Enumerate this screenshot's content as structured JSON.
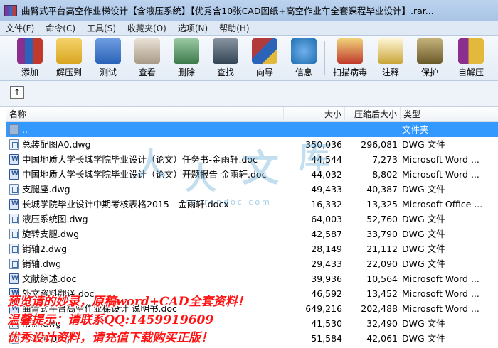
{
  "window": {
    "title": "曲臂式平台高空作业梯设计【含液压系统】【优秀含10张CAD图纸+高空作业车全套课程毕业设计】.rar..."
  },
  "menu": [
    "文件(F)",
    "命令(C)",
    "工具(S)",
    "收藏夹(O)",
    "选项(N)",
    "帮助(H)"
  ],
  "toolbar": [
    {
      "label": "添加",
      "icon": "add-books-icon",
      "color": "#8b2f8f"
    },
    {
      "label": "解压到",
      "icon": "extract-folder-icon",
      "color": "#d9a520"
    },
    {
      "label": "测试",
      "icon": "test-check-icon",
      "color": "#2a63b8"
    },
    {
      "label": "查看",
      "icon": "view-glasses-icon",
      "color": "#7b6a5a"
    },
    {
      "label": "删除",
      "icon": "delete-bin-icon",
      "color": "#3c7a4a"
    },
    {
      "label": "查找",
      "icon": "find-binoculars-icon",
      "color": "#334455"
    },
    {
      "label": "向导",
      "icon": "wizard-icon",
      "color": "#b33a3a"
    },
    {
      "label": "信息",
      "icon": "info-icon",
      "color": "#1f6fb3"
    },
    {
      "label": "扫描病毒",
      "icon": "scan-virus-icon",
      "color": "#c0392b"
    },
    {
      "label": "注释",
      "icon": "comment-icon",
      "color": "#c9a437"
    },
    {
      "label": "保护",
      "icon": "protect-shield-icon",
      "color": "#6b5a2a"
    },
    {
      "label": "自解压",
      "icon": "sfx-icon",
      "color": "#8b2f8f"
    }
  ],
  "address": {
    "up_label": "↑"
  },
  "columns": {
    "name": "名称",
    "size": "大小",
    "packed": "压缩后大小",
    "type": "类型"
  },
  "files": [
    {
      "name": "..",
      "size": "",
      "packed": "",
      "type": "文件夹",
      "kind": "folder",
      "selected": true
    },
    {
      "name": "总装配图A0.dwg",
      "size": "350,036",
      "packed": "296,081",
      "type": "DWG 文件",
      "kind": "dwg"
    },
    {
      "name": "中国地质大学长城学院毕业设计（论文）任务书-金雨轩.doc",
      "size": "44,544",
      "packed": "7,273",
      "type": "Microsoft Word ...",
      "kind": "word"
    },
    {
      "name": "中国地质大学长城学院毕业设计（论文）开题报告-金雨轩.doc",
      "size": "44,032",
      "packed": "8,802",
      "type": "Microsoft Word ...",
      "kind": "word"
    },
    {
      "name": "支腿座.dwg",
      "size": "49,433",
      "packed": "40,387",
      "type": "DWG 文件",
      "kind": "dwg"
    },
    {
      "name": "长城学院毕业设计中期考核表格2015 - 金雨轩.docx",
      "size": "16,332",
      "packed": "13,325",
      "type": "Microsoft Office ...",
      "kind": "word"
    },
    {
      "name": "液压系统图.dwg",
      "size": "64,003",
      "packed": "52,760",
      "type": "DWG 文件",
      "kind": "dwg"
    },
    {
      "name": "旋转支腿.dwg",
      "size": "42,587",
      "packed": "33,790",
      "type": "DWG 文件",
      "kind": "dwg"
    },
    {
      "name": "销轴2.dwg",
      "size": "28,149",
      "packed": "21,112",
      "type": "DWG 文件",
      "kind": "dwg"
    },
    {
      "name": "销轴.dwg",
      "size": "29,433",
      "packed": "22,090",
      "type": "DWG 文件",
      "kind": "dwg"
    },
    {
      "name": "文献综述.doc",
      "size": "39,936",
      "packed": "10,564",
      "type": "Microsoft Word ...",
      "kind": "word"
    },
    {
      "name": "外文资料翻译.doc",
      "size": "46,592",
      "packed": "13,452",
      "type": "Microsoft Word ...",
      "kind": "word"
    },
    {
      "name": "曲臂式平台高空作业梯设计 说明书.doc",
      "size": "649,216",
      "packed": "202,488",
      "type": "Microsoft Word ...",
      "kind": "word"
    },
    {
      "name": "吊篮.dwg",
      "size": "41,530",
      "packed": "32,490",
      "type": "DWG 文件",
      "kind": "dwg"
    },
    {
      "name": "大车轮.dwg",
      "size": "51,584",
      "packed": "42,061",
      "type": "DWG 文件",
      "kind": "dwg"
    }
  ],
  "overlay": {
    "watermark_chars": [
      "人",
      "人",
      "文",
      "库"
    ],
    "watermark_url": "renrendoc.com",
    "promo_lines": [
      "预览请的妙录，原稿word+CAD全套资料！",
      "温馨提示：请联系QQ:1459919609",
      "优秀设计资料，请充值下载购买正版！"
    ]
  }
}
